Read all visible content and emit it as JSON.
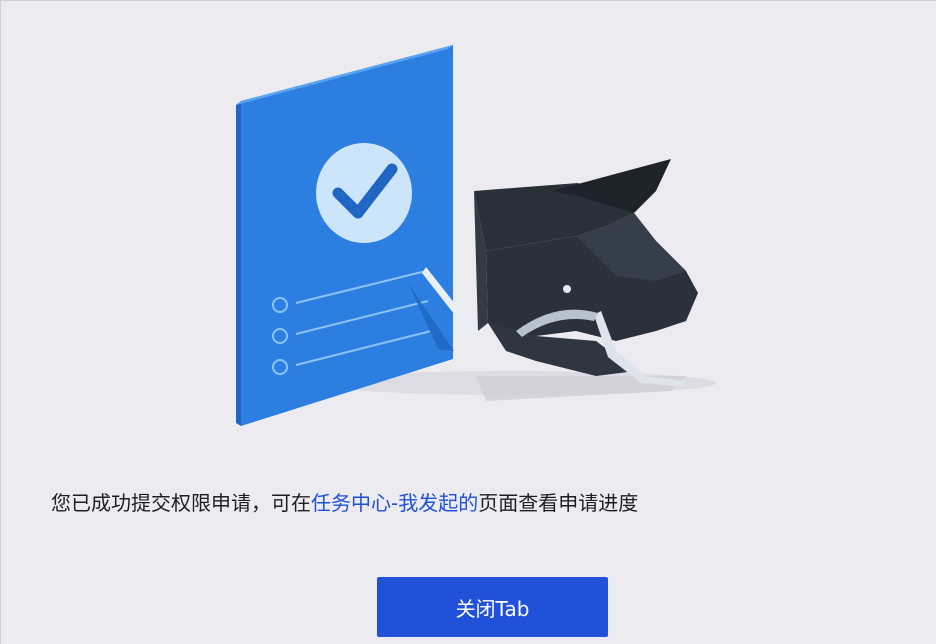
{
  "message": {
    "prefix": "您已成功提交权限申请，可在",
    "link": "任务中心-我发起的",
    "suffix": "页面查看申请进度"
  },
  "close_button": {
    "label": "关闭Tab"
  },
  "colors": {
    "accent": "#2151d8",
    "document": "#2c7fe0",
    "background": "#ecebf0"
  },
  "illustration": {
    "icons": [
      "document-icon",
      "check-icon",
      "helmet-icon"
    ]
  }
}
